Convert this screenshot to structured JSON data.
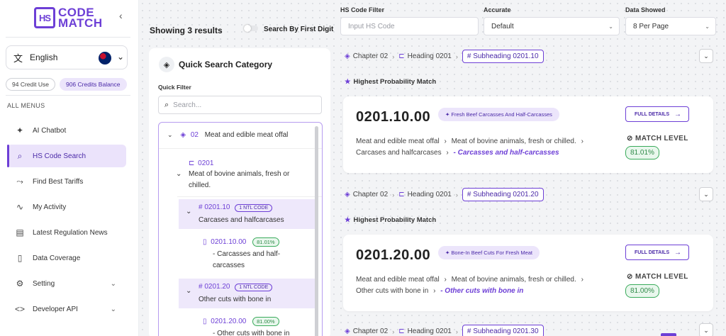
{
  "brand": {
    "logo_mark": "HS",
    "line1": "CODE",
    "line2": "MATCH",
    "color": "#6d3fd6"
  },
  "sidebar": {
    "language": "English",
    "credit_use": "94 Credit Use",
    "credits_balance": "906 Credits Balance",
    "menus_label": "ALL MENUS",
    "items": [
      {
        "label": "AI Chatbot",
        "icon": "sparkle-icon"
      },
      {
        "label": "HS Code Search",
        "icon": "search-icon",
        "active": true
      },
      {
        "label": "Find Best Tariffs",
        "icon": "trend-icon"
      },
      {
        "label": "My Activity",
        "icon": "activity-icon"
      },
      {
        "label": "Latest Regulation News",
        "icon": "news-icon"
      },
      {
        "label": "Data Coverage",
        "icon": "document-icon"
      },
      {
        "label": "Setting",
        "icon": "gear-icon"
      },
      {
        "label": "Developer API",
        "icon": "code-icon"
      }
    ]
  },
  "header": {
    "showing": "Showing 3 results",
    "toggle_label": "Search By First Digit",
    "filters": {
      "hs_code_label": "HS Code Filter",
      "hs_code_placeholder": "Input HS Code",
      "accurate_label": "Accurate",
      "accurate_value": "Default",
      "data_label": "Data Showed",
      "data_value": "8 Per Page"
    }
  },
  "quick_search": {
    "title": "Quick Search Category",
    "filter_label": "Quick Filter",
    "search_placeholder": "Search...",
    "chapter": {
      "code": "02",
      "label": "Meat and edible meat offal"
    },
    "heading": {
      "code": "0201",
      "label_line1": "Meat of bovine animals, fresh or",
      "label_line2": "chilled."
    },
    "subheadings": [
      {
        "code": "# 0201.10",
        "tag": "1 NTL CODE",
        "label": "Carcases and halfcarcases",
        "leaf": {
          "code": "0201.10.00",
          "pct": "81.01%",
          "line1": "- Carcasses and half-",
          "line2": "carcasses"
        }
      },
      {
        "code": "# 0201.20",
        "tag": "1 NTL CODE",
        "label": "Other cuts with bone in",
        "leaf": {
          "code": "0201.20.00",
          "pct": "81.00%",
          "line1": "- Other cuts with bone in",
          "line2": ""
        }
      }
    ]
  },
  "results": [
    {
      "chapter": "Chapter 02",
      "heading": "Heading 0201",
      "subheading": "# Subheading 0201.10",
      "hpm": "Highest Probability Match",
      "code": "0201.10.00",
      "badge": "Fresh Beef Carcasses And Half-Carcasses",
      "full_details": "FULL DETAILS",
      "path_line1_a": "Meat and edible meat offal",
      "path_line1_b": "Meat of bovine animals, fresh or chilled.",
      "path_line2_a": "Carcases and halfcarcases",
      "path_line2_b": "- Carcasses and half-carcasses",
      "match_label": "MATCH LEVEL",
      "match_value": "81.01%"
    },
    {
      "chapter": "Chapter 02",
      "heading": "Heading 0201",
      "subheading": "# Subheading 0201.20",
      "hpm": "Highest Probability Match",
      "code": "0201.20.00",
      "badge": "Bone-In Beef Cuts For Fresh Meat",
      "full_details": "FULL DETAILS",
      "path_line1_a": "Meat and edible meat offal",
      "path_line1_b": "Meat of bovine animals, fresh or chilled.",
      "path_line2_a": "Other cuts with bone in",
      "path_line2_b": "- Other cuts with bone in",
      "match_label": "MATCH LEVEL",
      "match_value": "81.00%"
    },
    {
      "chapter": "Chapter 02",
      "heading": "Heading 0201",
      "subheading": "# Subheading 0201.30"
    }
  ]
}
